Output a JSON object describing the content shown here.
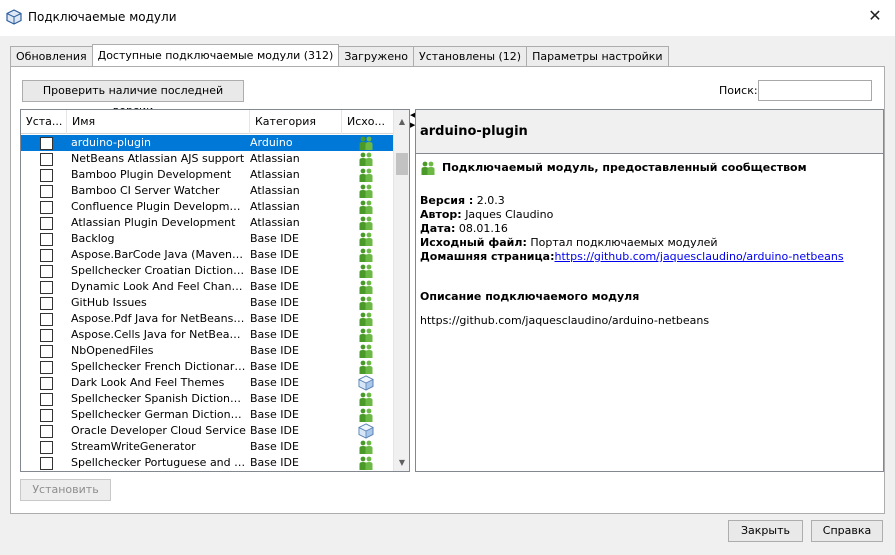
{
  "window": {
    "title": "Подключаемые модули",
    "close_glyph": "✕"
  },
  "tabs": [
    {
      "label": "Обновления",
      "active": false
    },
    {
      "label": "Доступные подключаемые модули (312)",
      "active": true
    },
    {
      "label": "Загружено",
      "active": false
    },
    {
      "label": "Установлены (12)",
      "active": false
    },
    {
      "label": "Параметры настройки",
      "active": false
    }
  ],
  "toolbar": {
    "check_latest_label": "Проверить наличие последней версии",
    "search_label": "Поиск:",
    "search_value": ""
  },
  "table": {
    "columns": {
      "install": "Уста...",
      "name": "Имя",
      "category": "Категория",
      "source": "Исхо..."
    },
    "rows": [
      {
        "name": "arduino-plugin",
        "category": "Arduino",
        "source_icon": "community-icon",
        "selected": true
      },
      {
        "name": "NetBeans Atlassian AJS support",
        "category": "Atlassian",
        "source_icon": "community-icon"
      },
      {
        "name": "Bamboo Plugin Development",
        "category": "Atlassian",
        "source_icon": "community-icon"
      },
      {
        "name": "Bamboo CI Server Watcher",
        "category": "Atlassian",
        "source_icon": "community-icon"
      },
      {
        "name": "Confluence Plugin Development",
        "category": "Atlassian",
        "source_icon": "community-icon"
      },
      {
        "name": "Atlassian Plugin Development",
        "category": "Atlassian",
        "source_icon": "community-icon"
      },
      {
        "name": "Backlog",
        "category": "Base IDE",
        "source_icon": "community-icon"
      },
      {
        "name": "Aspose.BarCode Java (Maven) fo...",
        "category": "Base IDE",
        "source_icon": "community-icon"
      },
      {
        "name": "Spellchecker Croatian Dictionary",
        "category": "Base IDE",
        "source_icon": "community-icon"
      },
      {
        "name": "Dynamic Look And Feel Changer",
        "category": "Base IDE",
        "source_icon": "community-icon"
      },
      {
        "name": "GitHub Issues",
        "category": "Base IDE",
        "source_icon": "community-icon"
      },
      {
        "name": "Aspose.Pdf Java for NetBeans (M...",
        "category": "Base IDE",
        "source_icon": "community-icon"
      },
      {
        "name": "Aspose.Cells Java for NetBeans (...",
        "category": "Base IDE",
        "source_icon": "community-icon"
      },
      {
        "name": "NbOpenedFiles",
        "category": "Base IDE",
        "source_icon": "community-icon"
      },
      {
        "name": "Spellchecker French Dictionaries",
        "category": "Base IDE",
        "source_icon": "community-icon"
      },
      {
        "name": "Dark Look And Feel Themes",
        "category": "Base IDE",
        "source_icon": "cube-icon"
      },
      {
        "name": "Spellchecker Spanish Dictionaries",
        "category": "Base IDE",
        "source_icon": "community-icon"
      },
      {
        "name": "Spellchecker German Dictionaries",
        "category": "Base IDE",
        "source_icon": "community-icon"
      },
      {
        "name": "Oracle Developer Cloud Service",
        "category": "Base IDE",
        "source_icon": "cube-icon"
      },
      {
        "name": "StreamWriteGenerator",
        "category": "Base IDE",
        "source_icon": "community-icon"
      },
      {
        "name": "Spellchecker Portuguese and Brazi...",
        "category": "Base IDE",
        "source_icon": "community-icon"
      }
    ]
  },
  "detail": {
    "title": "arduino-plugin",
    "kind": "Подключаемый модуль, предоставленный сообществом",
    "version_label": "Версия :",
    "version_value": "2.0.3",
    "author_label": "Автор:",
    "author_value": "Jaques Claudino",
    "date_label": "Дата:",
    "date_value": "08.01.16",
    "source_label": "Исходный файл:",
    "source_value": "Портал подключаемых модулей",
    "homepage_label": "Домашняя страница:",
    "homepage_url": "https://github.com/jaquesclaudino/arduino-netbeans",
    "description_title": "Описание подключаемого модуля",
    "description": "https://github.com/jaquesclaudino/arduino-netbeans"
  },
  "actions": {
    "install_label": "Установить",
    "close_label": "Закрыть",
    "help_label": "Справка"
  },
  "colors": {
    "selection": "#0078d7",
    "link": "#0000ee",
    "community_icon": "#4a9a2a",
    "cube_icon": "#7aa6d6"
  }
}
